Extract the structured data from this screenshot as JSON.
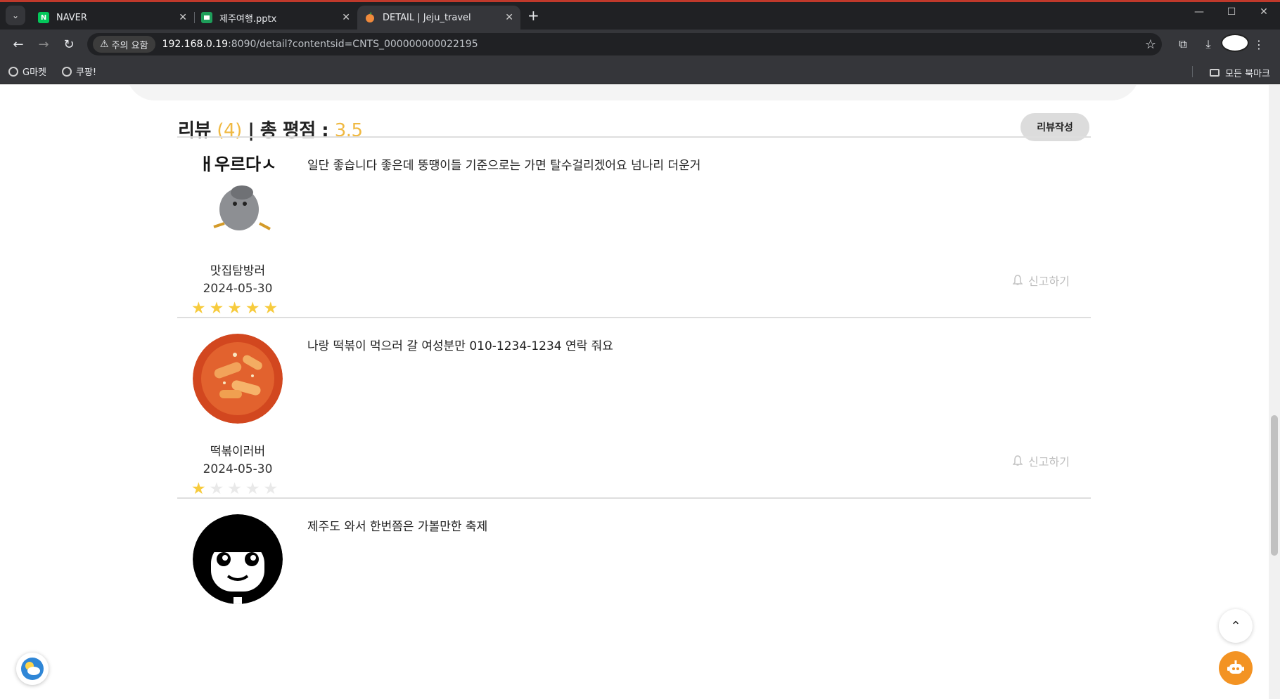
{
  "browser": {
    "tabs": [
      {
        "title": "NAVER",
        "favicon": "N",
        "favicon_color": "#03c75a",
        "active": false
      },
      {
        "title": "제주여행.pptx",
        "favicon": "",
        "favicon_color": "#1e9e5a",
        "active": false
      },
      {
        "title": "DETAIL | Jeju_travel",
        "favicon": "",
        "favicon_color": "#f08a3c",
        "active": true
      }
    ],
    "security_chip": "주의 요함",
    "url_host": "192.168.0.19",
    "url_rest": ":8090/detail?contentsid=CNTS_000000000022195",
    "bookmarks": [
      "G마켓",
      "쿠팡!"
    ],
    "all_bookmarks": "모든 북마크"
  },
  "reviews_section": {
    "title_label": "리뷰",
    "count_text": "(4)",
    "separator": "|",
    "rating_label": "총 평점 :",
    "rating_value": "3.5",
    "write_button": "리뷰작성",
    "accent_color": "#f0b942"
  },
  "reviews": [
    {
      "nickname": "맛집탐방러",
      "date": "2024-05-30",
      "rating": 5,
      "comment": "일단 좋습니다 좋은데 뚱땡이들 기준으로는 가면 탈수걸리겠어요 넘나리 더운거",
      "report_label": "신고하기",
      "avatar_text": "ㅐ우르다ㅅ"
    },
    {
      "nickname": "떡볶이러버",
      "date": "2024-05-30",
      "rating": 1,
      "comment": "나랑 떡볶이 먹으러 갈 여성분만 010-1234-1234 연락 줘요",
      "report_label": "신고하기"
    },
    {
      "comment": "제주도 와서 한번쯤은 가볼만한 축제"
    }
  ]
}
